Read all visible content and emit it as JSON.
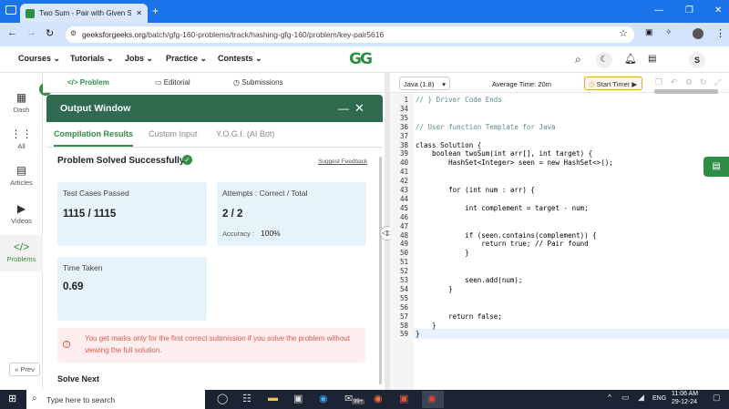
{
  "browser": {
    "tab_title": "Two Sum - Pair with Given Sum",
    "close_tab": "✕",
    "new_tab": "+",
    "url_host": "geeksforgeeks.org",
    "url_path": "/batch/gfg-160-problems/track/hashing-gfg-160/problem/key-pair5616"
  },
  "site": {
    "logo": "GG",
    "nav": [
      "Courses",
      "Tutorials",
      "Jobs",
      "Practice",
      "Contests"
    ],
    "avatar": "S"
  },
  "rail": [
    {
      "label": "Dash",
      "icon": "dashboard-icon"
    },
    {
      "label": "All",
      "icon": "grid-icon"
    },
    {
      "label": "Articles",
      "icon": "article-icon"
    },
    {
      "label": "Videos",
      "icon": "video-icon"
    },
    {
      "label": "Problems",
      "icon": "code-icon"
    }
  ],
  "prev_label": "« Prev",
  "problem_tabs": [
    "Problem",
    "Editorial",
    "Submissions"
  ],
  "output": {
    "title": "Output Window",
    "tabs": [
      "Compilation Results",
      "Custom Input",
      "Y.O.G.I. (AI Bot)"
    ],
    "status": "Problem Solved Successfully",
    "suggest": "Suggest Feedback",
    "tests_label": "Test Cases Passed",
    "tests_value": "1115 / 1115",
    "attempts_label": "Attempts : Correct / Total",
    "attempts_value": "2 / 2",
    "accuracy_label": "Accuracy :",
    "accuracy_value": "100%",
    "time_label": "Time Taken",
    "time_value": "0.69",
    "warning": "You get marks only for the first correct submission if you solve the problem without viewing the full solution.",
    "solve_next": "Solve Next"
  },
  "editor": {
    "language": "Java (1.8)",
    "avg_time": "Average Time: 20m",
    "timer": "Start Timer",
    "lines": [
      {
        "n": "1",
        "t": "// } Driver Code Ends"
      },
      {
        "n": "34",
        "t": ""
      },
      {
        "n": "35",
        "t": ""
      },
      {
        "n": "36",
        "t": "// User function Template for Java"
      },
      {
        "n": "37",
        "t": ""
      },
      {
        "n": "38",
        "t": "class Solution {"
      },
      {
        "n": "39",
        "t": "    boolean twoSum(int arr[], int target) {"
      },
      {
        "n": "40",
        "t": "        HashSet<Integer> seen = new HashSet<>();"
      },
      {
        "n": "41",
        "t": ""
      },
      {
        "n": "42",
        "t": ""
      },
      {
        "n": "43",
        "t": "        for (int num : arr) {"
      },
      {
        "n": "44",
        "t": ""
      },
      {
        "n": "45",
        "t": "            int complement = target - num;"
      },
      {
        "n": "46",
        "t": ""
      },
      {
        "n": "47",
        "t": ""
      },
      {
        "n": "48",
        "t": "            if (seen.contains(complement)) {"
      },
      {
        "n": "49",
        "t": "                return true; // Pair found"
      },
      {
        "n": "50",
        "t": "            }"
      },
      {
        "n": "51",
        "t": ""
      },
      {
        "n": "52",
        "t": ""
      },
      {
        "n": "53",
        "t": "            seen.add(num);"
      },
      {
        "n": "54",
        "t": "        }"
      },
      {
        "n": "55",
        "t": ""
      },
      {
        "n": "56",
        "t": ""
      },
      {
        "n": "57",
        "t": "        return false;"
      },
      {
        "n": "58",
        "t": "    }"
      },
      {
        "n": "59",
        "t": "}"
      }
    ]
  },
  "taskbar": {
    "search": "Type here to search",
    "badge": "99+",
    "lang": "ENG",
    "time": "11:06 AM",
    "date": "29-12-24"
  },
  "colors": {
    "accent": "#2f8d46",
    "header": "#2f6b4e",
    "card": "#e6f3fb",
    "warn": "#e0584f"
  }
}
